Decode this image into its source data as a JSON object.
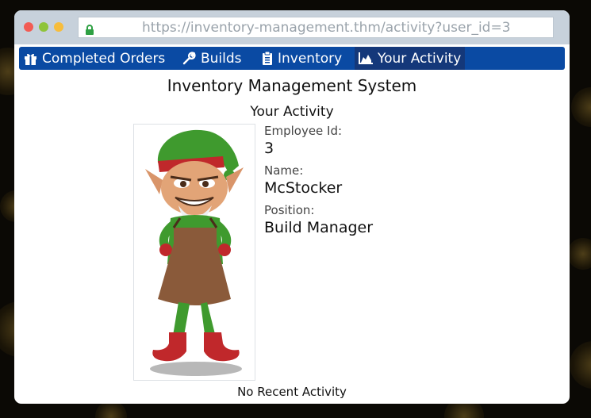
{
  "browser": {
    "url": "https://inventory-management.thm/activity?user_id=3"
  },
  "nav": {
    "items": [
      {
        "label": "Completed Orders",
        "icon": "gift-icon"
      },
      {
        "label": "Builds",
        "icon": "wrench-icon"
      },
      {
        "label": "Inventory",
        "icon": "clipboard-icon"
      },
      {
        "label": "Your Activity",
        "icon": "area-chart-icon",
        "active": true
      }
    ]
  },
  "page": {
    "app_title": "Inventory Management System",
    "section_title": "Your Activity"
  },
  "profile": {
    "employee_id_label": "Employee Id:",
    "employee_id": "3",
    "name_label": "Name:",
    "name": "McStocker",
    "position_label": "Position:",
    "position": "Build Manager"
  },
  "activity": {
    "empty_text": "No Recent Activity"
  },
  "colors": {
    "nav_bg": "#0a4aa3",
    "nav_active": "#14387a",
    "titlebar": "#c7d1db"
  }
}
